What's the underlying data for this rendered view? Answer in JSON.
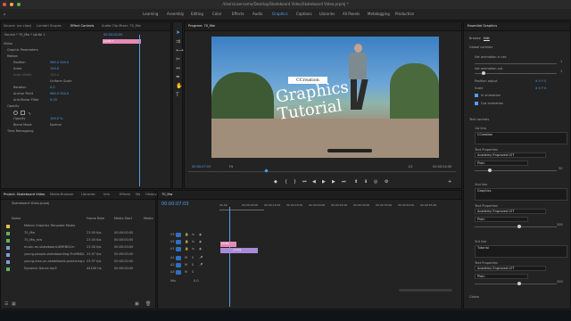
{
  "window": {
    "title": "/Users/username/Desktop/Skateboard Video/Skateboard Video.prproj *"
  },
  "workspaces": [
    "Learning",
    "Assembly",
    "Editing",
    "Color",
    "Effects",
    "Audio",
    "Graphics",
    "Captions",
    "Libraries",
    "All Panels",
    "Metalogging",
    "Production"
  ],
  "active_workspace": "Graphics",
  "effect_controls": {
    "tabs": [
      "Source: (no clips)",
      "Lumetri Scopes",
      "Effect Controls",
      "Audio Clip Mixer: 70_Mw"
    ],
    "source_label": "Source * 70_Mw * sArtbl 1",
    "clip_label": "70_Mw * sArtbl 1",
    "timecode": "00:00:00:00",
    "clip_bar": "sArtbl 1",
    "rows": [
      {
        "label": "Video",
        "value": "",
        "indent": 0
      },
      {
        "label": "Graphic Parameters",
        "value": "",
        "indent": 1
      },
      {
        "label": "Motion",
        "value": "",
        "indent": 1
      },
      {
        "label": "Position",
        "value": "960.0  540.0",
        "indent": 2
      },
      {
        "label": "Scale",
        "value": "100.0",
        "indent": 2
      },
      {
        "label": "Scale Width",
        "value": "100.0",
        "indent": 2
      },
      {
        "label": "",
        "value": "Uniform Scale",
        "indent": 2
      },
      {
        "label": "Rotation",
        "value": "0.0",
        "indent": 2
      },
      {
        "label": "Anchor Point",
        "value": "960.0  540.0",
        "indent": 2
      },
      {
        "label": "Anti-flicker Filter",
        "value": "0.00",
        "indent": 2
      },
      {
        "label": "Opacity",
        "value": "",
        "indent": 1
      },
      {
        "label": "Opacity",
        "value": "100.0 %",
        "indent": 2
      },
      {
        "label": "Blend Mode",
        "value": "Normal",
        "indent": 2
      },
      {
        "label": "Time Remapping",
        "value": "",
        "indent": 1
      }
    ]
  },
  "program_monitor": {
    "title": "Program: 70_Mw",
    "overlay_small": "CCreation",
    "overlay_title_1": "Graphics",
    "overlay_title_2": "Tutorial",
    "timecode_left": "00:00:07:03",
    "fit": "Fit",
    "quality": "1/2",
    "timecode_right": "00:00:24:00"
  },
  "essential_graphics": {
    "header": "Essential Graphics",
    "tabs": [
      "Browse",
      "Edit"
    ],
    "active_tab": "Edit",
    "global_controls": "Global controls",
    "sections": [
      {
        "label": "Set animation in sec",
        "value": "1"
      },
      {
        "label": "Set animation out",
        "value": "1"
      },
      {
        "label": "Position adjust",
        "value": "X 0  Y 0"
      },
      {
        "label": "Scale",
        "value": "X 0  Y 0"
      }
    ],
    "checkbox_in": "In animation",
    "checkbox_out": "Out animation",
    "text_controls": "Text controls",
    "text_blocks": [
      {
        "label": "1st line",
        "value": "CCreation",
        "props_label": "Text Properties",
        "font": "Academy Engraved LET",
        "style": "Plain"
      },
      {
        "label": "2nd line",
        "value": "Graphics",
        "props_label": "Text Properties",
        "font": "Academy Engraved LET",
        "style": "Plain"
      },
      {
        "label": "3rd line",
        "value": "Tutorial",
        "props_label": "Text Properties",
        "font": "Academy Engraved LET",
        "style": "Plain"
      }
    ],
    "values_right": [
      "30",
      "200",
      "200"
    ],
    "colors": "Colors"
  },
  "project": {
    "tabs": [
      "Project: Skateboard Video",
      "Media Browser",
      "Libraries",
      "Info",
      "Effects",
      "Ma",
      "History"
    ],
    "file": "Skateboard Video.prproj",
    "columns": [
      "Name",
      "Frame Rate",
      "Media Start",
      "Media"
    ],
    "items": [
      {
        "name": "Motion Graphics Template Media",
        "fps": "",
        "start": "",
        "color": "#e0c14f"
      },
      {
        "name": "70_Mw",
        "fps": "23.00 fps",
        "start": "00:00:00:00",
        "color": "#5fb35f"
      },
      {
        "name": "70_Mw_mw",
        "fps": "23.00 fps",
        "start": "00:00:00:00",
        "color": "#5fb35f"
      },
      {
        "name": "music-on-skateboard-6MEBGCm",
        "fps": "23.00 fps",
        "start": "00:00:00:00",
        "color": "#7f9ed6"
      },
      {
        "name": "young-people-skateboarding-PrvMB8/Lmm",
        "fps": "23.97 fps",
        "start": "00:00:00:00",
        "color": "#7f9ed6"
      },
      {
        "name": "young-man-on-skateboard-practicing-on-ss",
        "fps": "23.97 fps",
        "start": "00:00:00:00",
        "color": "#7f9ed6"
      },
      {
        "name": "Dynamic Dance.mp3",
        "fps": "44100 Hz",
        "start": "00:00:00:00",
        "color": "#5fb35f"
      }
    ]
  },
  "timeline": {
    "tab": "70_Mw",
    "timecode": "00:00:07:03",
    "ruler": [
      "00:00",
      "00:00:05:00",
      "00:00:10:00",
      "00:00:15:00",
      "00:00:20:00",
      "00:00:25:00",
      "00:00:30:00",
      "00:00:35:00",
      "00:00:40:00",
      "00:00:45:00"
    ],
    "tracks": [
      "V3",
      "V2",
      "V1",
      "A1",
      "A2",
      "A3",
      "Mix"
    ],
    "clip_graphic": "sArtbl",
    "clip_video": "young"
  }
}
